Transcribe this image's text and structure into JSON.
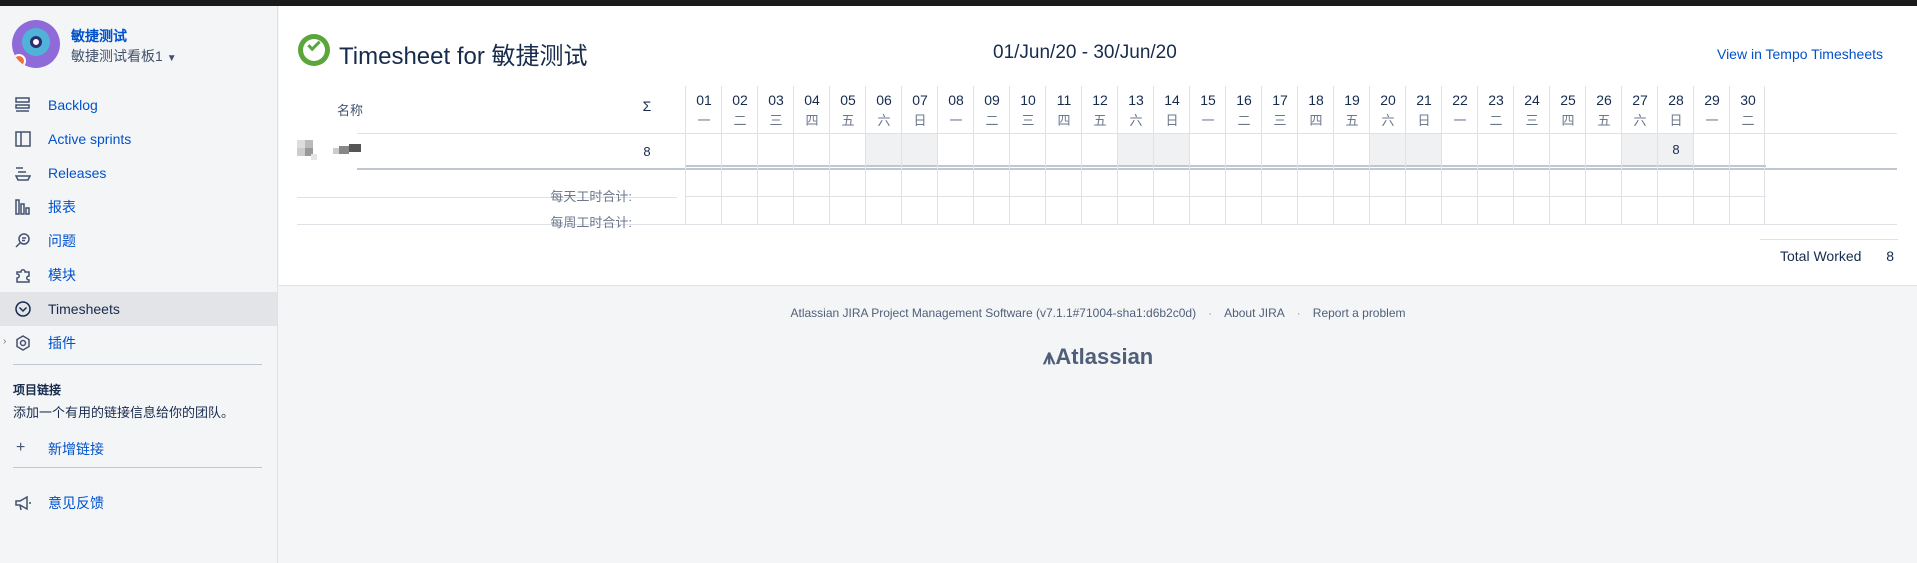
{
  "project": {
    "name": "敏捷测试",
    "board": "敏捷测试看板1"
  },
  "nav": {
    "items": [
      {
        "label": "Backlog",
        "icon": "backlog-icon"
      },
      {
        "label": "Active sprints",
        "icon": "board-icon"
      },
      {
        "label": "Releases",
        "icon": "ship-icon"
      },
      {
        "label": "报表",
        "icon": "chart-icon"
      },
      {
        "label": "问题",
        "icon": "issue-search-icon"
      },
      {
        "label": "模块",
        "icon": "puzzle-icon"
      },
      {
        "label": "Timesheets",
        "icon": "clock-icon"
      },
      {
        "label": "插件",
        "icon": "addon-icon"
      }
    ],
    "active": "Timesheets"
  },
  "project_links": {
    "title": "项目链接",
    "description": "添加一个有用的链接信息给你的团队。",
    "add_label": "新增链接"
  },
  "feedback": {
    "label": "意见反馈"
  },
  "timesheet": {
    "title": "Timesheet for 敏捷测试",
    "date_range": "01/Jun/20 - 30/Jun/20",
    "tempo_link": "View in Tempo Timesheets",
    "header_name": "名称",
    "header_sigma": "Σ",
    "days": [
      {
        "num": "01",
        "wd": "一"
      },
      {
        "num": "02",
        "wd": "二"
      },
      {
        "num": "03",
        "wd": "三"
      },
      {
        "num": "04",
        "wd": "四"
      },
      {
        "num": "05",
        "wd": "五"
      },
      {
        "num": "06",
        "wd": "六"
      },
      {
        "num": "07",
        "wd": "日"
      },
      {
        "num": "08",
        "wd": "一"
      },
      {
        "num": "09",
        "wd": "二"
      },
      {
        "num": "10",
        "wd": "三"
      },
      {
        "num": "11",
        "wd": "四"
      },
      {
        "num": "12",
        "wd": "五"
      },
      {
        "num": "13",
        "wd": "六"
      },
      {
        "num": "14",
        "wd": "日"
      },
      {
        "num": "15",
        "wd": "一"
      },
      {
        "num": "16",
        "wd": "二"
      },
      {
        "num": "17",
        "wd": "三"
      },
      {
        "num": "18",
        "wd": "四"
      },
      {
        "num": "19",
        "wd": "五"
      },
      {
        "num": "20",
        "wd": "六"
      },
      {
        "num": "21",
        "wd": "日"
      },
      {
        "num": "22",
        "wd": "一"
      },
      {
        "num": "23",
        "wd": "二"
      },
      {
        "num": "24",
        "wd": "三"
      },
      {
        "num": "25",
        "wd": "四"
      },
      {
        "num": "26",
        "wd": "五"
      },
      {
        "num": "27",
        "wd": "六"
      },
      {
        "num": "28",
        "wd": "日"
      },
      {
        "num": "29",
        "wd": "一"
      },
      {
        "num": "30",
        "wd": "二"
      }
    ],
    "user_row": {
      "total": "8",
      "day_values": {
        "28": "8"
      }
    },
    "daily_total_label": "每天工时合计:",
    "weekly_total_label": "每周工时合计:",
    "total_worked_label": "Total Worked",
    "total_worked_value": "8"
  },
  "footer": {
    "software": "Atlassian JIRA Project Management Software (v7.1.1#71004-sha1:d6b2c0d)",
    "about": "About JIRA",
    "report": "Report a problem",
    "logo": "Atlassian"
  }
}
